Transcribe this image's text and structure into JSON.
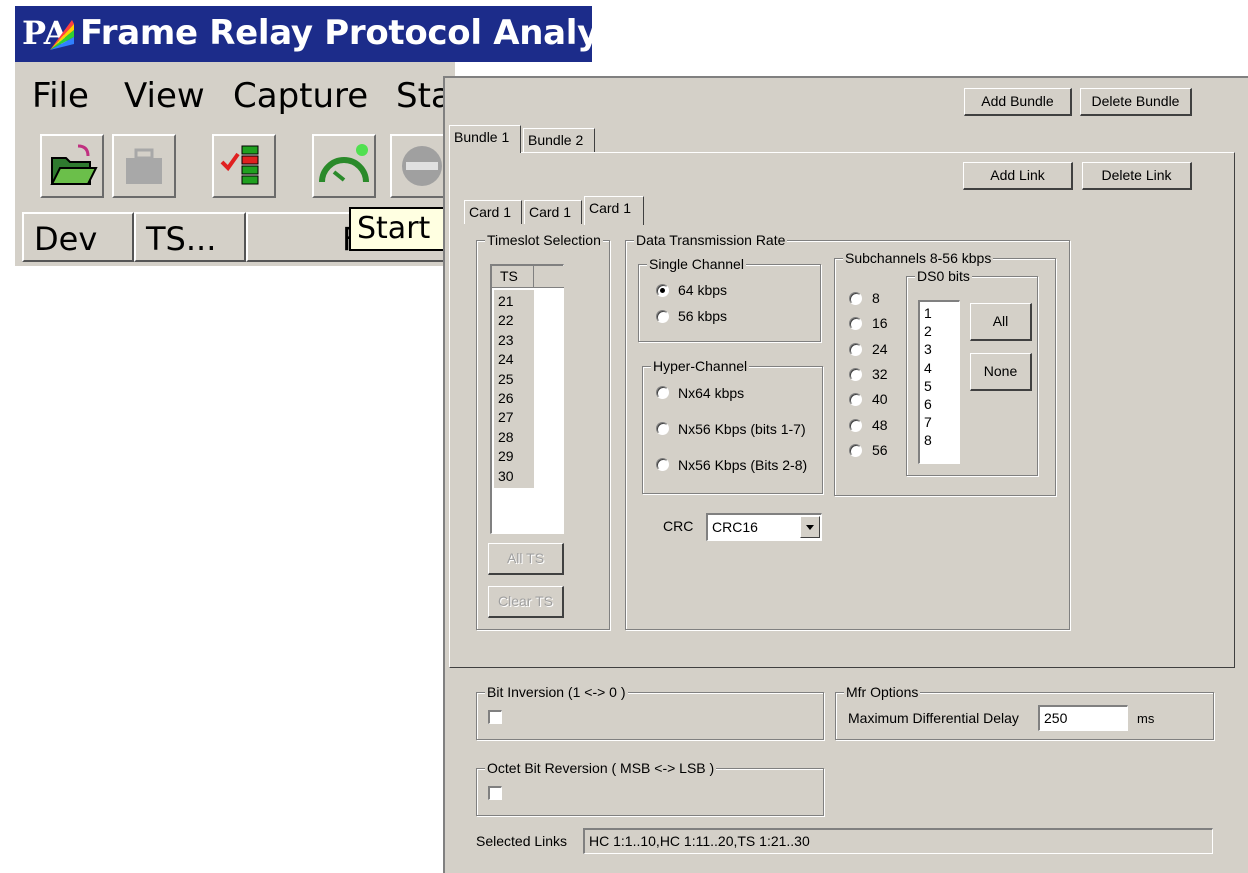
{
  "app": {
    "title": "Frame Relay Protocol Analys",
    "menu": [
      "File",
      "View",
      "Capture",
      "Sta"
    ],
    "tooltip": "Start",
    "columns": [
      "Dev",
      "TS...",
      "F"
    ]
  },
  "dialog": {
    "add_bundle": "Add Bundle",
    "delete_bundle": "Delete Bundle",
    "bundle_tabs": [
      "Bundle 1",
      "Bundle 2"
    ],
    "add_link": "Add Link",
    "delete_link": "Delete Link",
    "card_tabs": [
      "Card 1",
      "Card 1",
      "Card 1"
    ],
    "timeslot": {
      "title": "Timeslot Selection",
      "column": "TS",
      "items": [
        "21",
        "22",
        "23",
        "24",
        "25",
        "26",
        "27",
        "28",
        "29",
        "30"
      ],
      "all_ts": "All TS",
      "clear_ts": "Clear TS"
    },
    "rate": {
      "title": "Data Transmission Rate",
      "single": {
        "title": "Single Channel",
        "options": [
          "64 kbps",
          "56 kbps"
        ],
        "selected": "64 kbps"
      },
      "hyper": {
        "title": "Hyper-Channel",
        "options": [
          "Nx64 kbps",
          "Nx56 Kbps (bits 1-7)",
          "Nx56 Kbps (Bits 2-8)"
        ]
      },
      "subchannels": {
        "title": "Subchannels 8-56 kbps",
        "options": [
          "8",
          "16",
          "24",
          "32",
          "40",
          "48",
          "56"
        ]
      },
      "ds0": {
        "title": "DS0 bits",
        "items": [
          "1",
          "2",
          "3",
          "4",
          "5",
          "6",
          "7",
          "8"
        ],
        "all": "All",
        "none": "None"
      },
      "crc_label": "CRC",
      "crc_value": "CRC16"
    },
    "bit_inversion": "Bit Inversion (1 <-> 0 )",
    "octet_reversal": "Octet Bit Reversion ( MSB <-> LSB )",
    "mfr": {
      "title": "Mfr Options",
      "label": "Maximum Differential Delay",
      "value": "250",
      "unit": "ms"
    },
    "selected_links_label": "Selected Links",
    "selected_links_value": "HC 1:1..10,HC 1:11..20,TS 1:21..30"
  },
  "colors": {
    "titlebar": "#1c2c8a",
    "face": "#d4d0c8",
    "tooltip": "#ffffe1"
  }
}
